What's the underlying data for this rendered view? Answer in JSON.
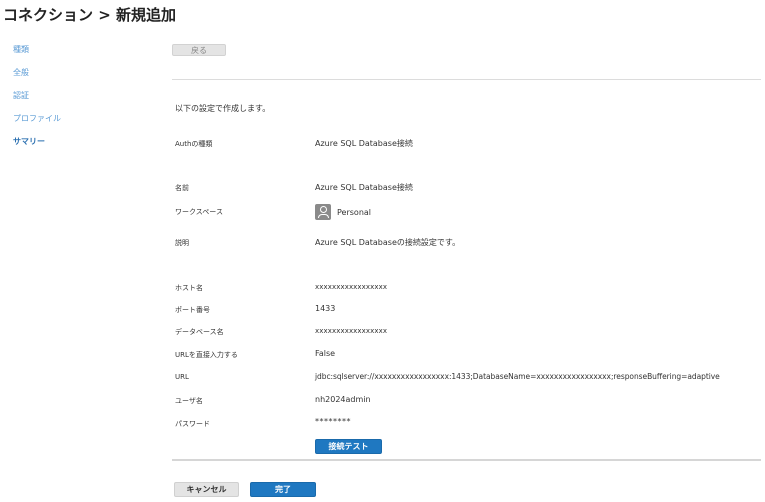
{
  "header": {
    "title": "コネクション > 新規追加"
  },
  "sidebar": {
    "items": [
      {
        "label": "種類"
      },
      {
        "label": "全般"
      },
      {
        "label": "認証"
      },
      {
        "label": "プロファイル"
      },
      {
        "label": "サマリー"
      }
    ],
    "active": "サマリー"
  },
  "toolbar": {
    "back_label": "戻る"
  },
  "summary": {
    "intro": "以下の設定で作成します。",
    "auth_type": {
      "label": "Authの種類",
      "value": "Azure SQL Database接続"
    },
    "name": {
      "label": "名前",
      "value": "Azure SQL Database接続"
    },
    "workspace": {
      "label": "ワークスペース",
      "value": "Personal",
      "icon": "user-icon"
    },
    "description": {
      "label": "説明",
      "value": "Azure SQL Databaseの接続設定です。"
    },
    "host": {
      "label": "ホスト名",
      "value": "xxxxxxxxxxxxxxxxx"
    },
    "port": {
      "label": "ポート番号",
      "value": "1433"
    },
    "database": {
      "label": "データベース名",
      "value": "xxxxxxxxxxxxxxxxx"
    },
    "url_direct": {
      "label": "URLを直接入力する",
      "value": "False"
    },
    "url": {
      "label": "URL",
      "value": "jdbc:sqlserver://xxxxxxxxxxxxxxxxx:1433;DatabaseName=xxxxxxxxxxxxxxxxx;responseBuffering=adaptive"
    },
    "user": {
      "label": "ユーザ名",
      "value": "nh2024admin"
    },
    "password": {
      "label": "パスワード",
      "value": "********"
    },
    "test_button_label": "接続テスト"
  },
  "footer": {
    "cancel_label": "キャンセル",
    "finish_label": "完了"
  },
  "colors": {
    "accent": "#1f78c1",
    "sidebar_link": "#5b9bd5",
    "sidebar_active": "#2a6fb0"
  }
}
